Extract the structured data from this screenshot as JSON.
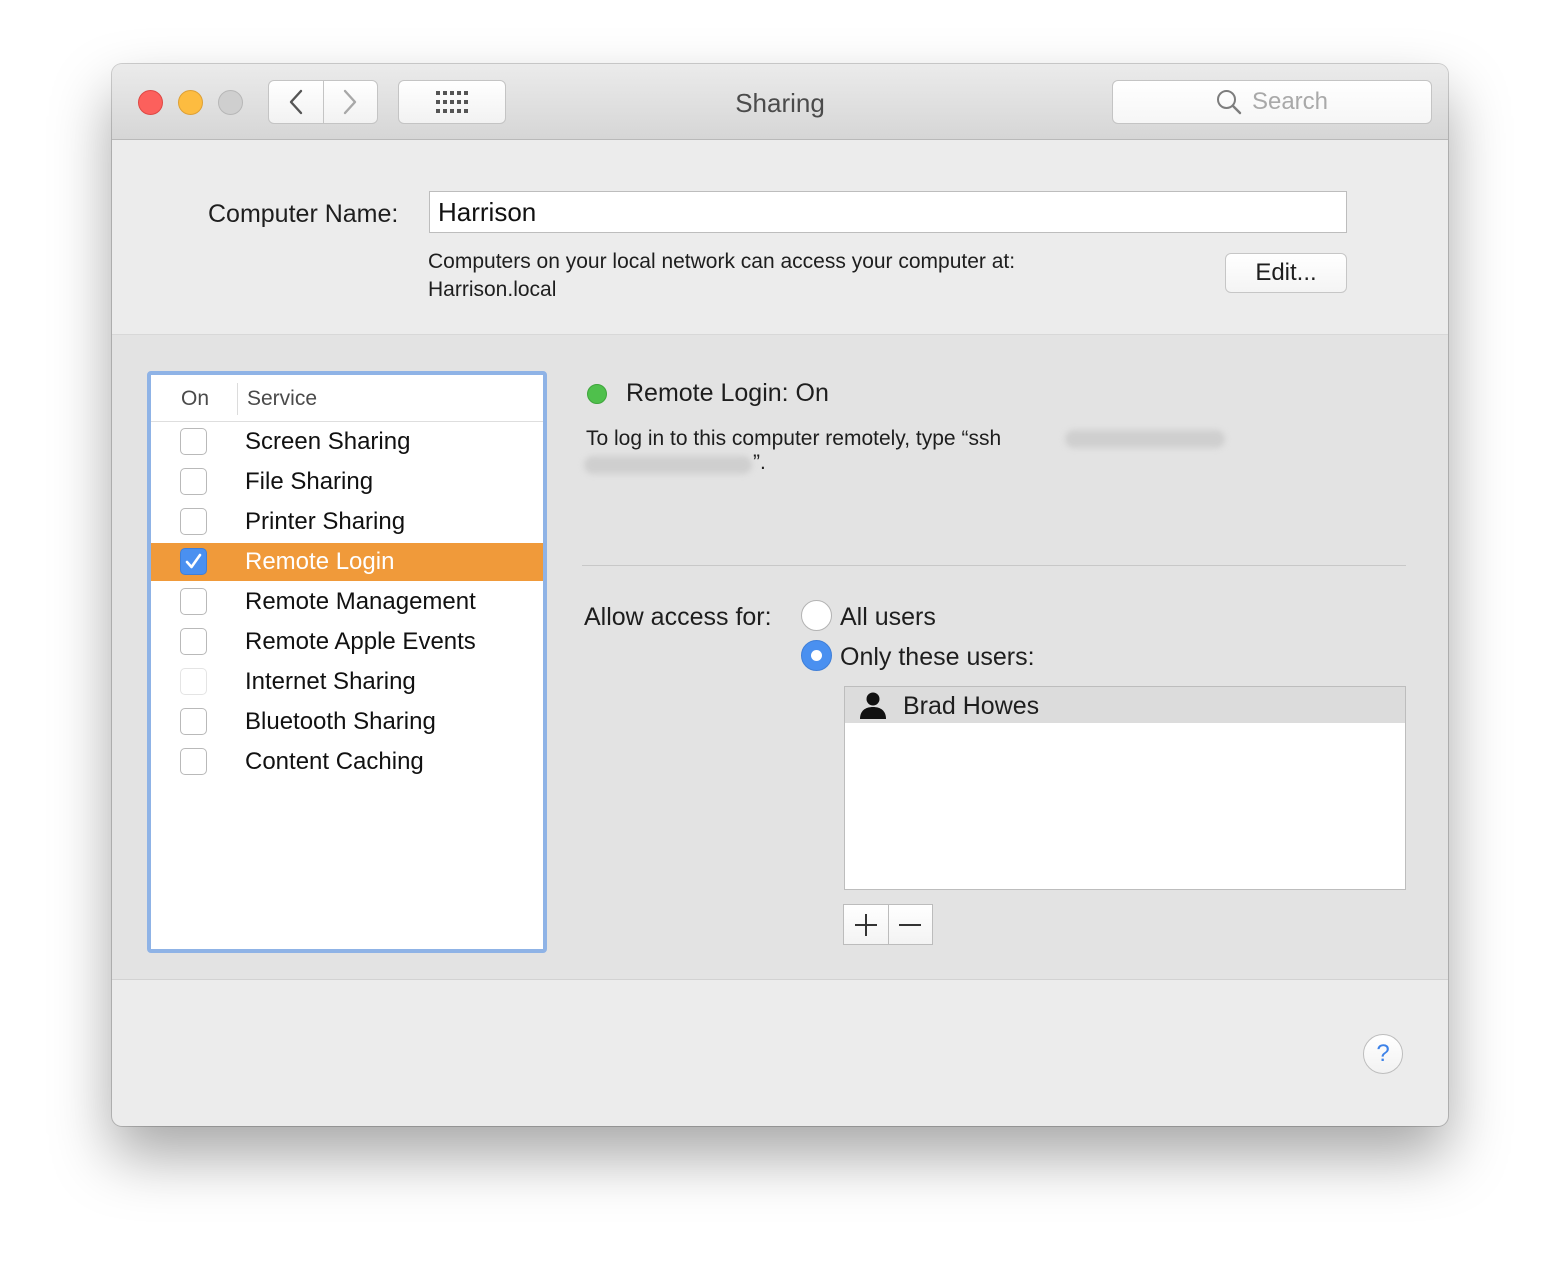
{
  "window": {
    "title": "Sharing"
  },
  "toolbar": {
    "search_placeholder": "Search",
    "back_icon": "chevron-left-icon",
    "forward_icon": "chevron-right-icon",
    "show_all_icon": "grid-dots-icon"
  },
  "computer_name": {
    "label": "Computer Name:",
    "value": "Harrison",
    "network_text": "Computers on your local network can access your computer at:",
    "local_address": "Harrison.local",
    "edit_label": "Edit..."
  },
  "services": {
    "header_on": "On",
    "header_service": "Service",
    "items": [
      {
        "label": "Screen Sharing",
        "checked": false,
        "enabled": true
      },
      {
        "label": "File Sharing",
        "checked": false,
        "enabled": true
      },
      {
        "label": "Printer Sharing",
        "checked": false,
        "enabled": true
      },
      {
        "label": "Remote Login",
        "checked": true,
        "enabled": true,
        "selected": true
      },
      {
        "label": "Remote Management",
        "checked": false,
        "enabled": true
      },
      {
        "label": "Remote Apple Events",
        "checked": false,
        "enabled": true
      },
      {
        "label": "Internet Sharing",
        "checked": false,
        "enabled": false
      },
      {
        "label": "Bluetooth Sharing",
        "checked": false,
        "enabled": true
      },
      {
        "label": "Content Caching",
        "checked": false,
        "enabled": true
      }
    ]
  },
  "detail": {
    "status": "Remote Login: On",
    "status_color": "#4fc04c",
    "instruction_prefix": "To log in to this computer remotely, type “ssh",
    "instruction_suffix": "”.",
    "allow_label": "Allow access for:",
    "radio_all": "All users",
    "radio_only": "Only these users:",
    "users": [
      "Brad Howes"
    ]
  },
  "colors": {
    "selection": "#f09a3a",
    "accent": "#4a90f0",
    "focus_ring": "#8fb3e6"
  },
  "help": {
    "label": "?"
  }
}
